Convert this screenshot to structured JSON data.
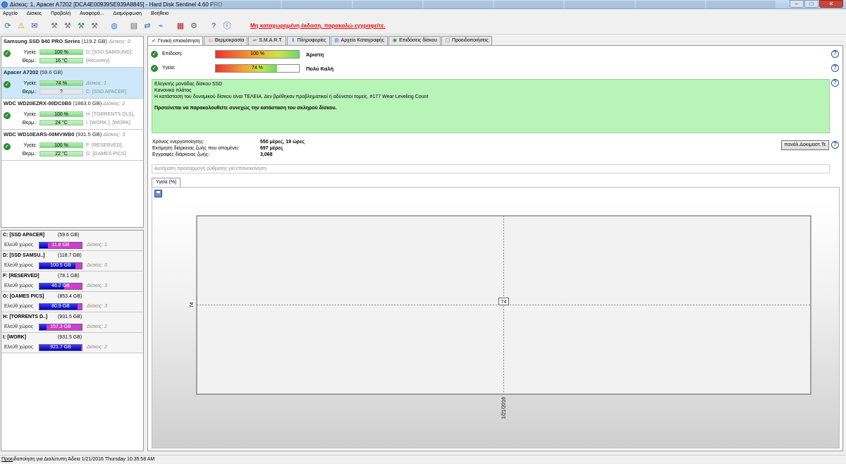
{
  "window": {
    "title": "Δίσκος: 1, Apacer A7202 [DCA4E00939SE939A8845]  -  Hard Disk Sentinel 4.60 PRO",
    "minimize": "–",
    "maximize": "□",
    "close": "✕"
  },
  "menu": [
    "Αρχείο",
    "Δίσκος",
    "Προβολή",
    "Αναφορά...",
    "Διαμόρφωση",
    "Βοήθεια"
  ],
  "toolbar": {
    "register_link": "Μη καταχωρημένη έκδοση, παρακαλώ εγγραφείτε."
  },
  "disks": [
    {
      "name": "Samsung SSD 840 PRO Series",
      "size": "(119.2 GB)",
      "disk_no": "Δίσκος: 0",
      "health_label": "Υγεία:",
      "health": "100 %",
      "health_vol": "D: [SSD SAMSUNG],",
      "temp_label": "Θερμ.:",
      "temp": "16 °C",
      "temp_vol": "[Recovery]"
    },
    {
      "name": "Apacer A7202",
      "size": "(59.6 GB)",
      "disk_no": "",
      "health_label": "Υγεία:",
      "health": "74 %",
      "health_vol": "Δίσκος: 1",
      "temp_label": "Θερμ.:",
      "temp": "?",
      "temp_vol": "C: [SSD APACER]"
    },
    {
      "name": "WDC WD20EZRX-00DC0B0",
      "size": "(1863.0 GB)",
      "disk_no": "Δίσκος: 2",
      "health_label": "Υγεία:",
      "health": "100 %",
      "health_vol": "H: [TORRENTS DLS],",
      "temp_label": "Θερμ.:",
      "temp": "24 °C",
      "temp_vol": "I: [WORK ],  [WORK]"
    },
    {
      "name": "WDC WD10EARS-00MVWB0",
      "size": "(931.5 GB)",
      "disk_no": "Δίσκος: 3",
      "health_label": "Υγεία:",
      "health": "100 %",
      "health_vol": "F: [RESERVED],",
      "temp_label": "Θερμ.:",
      "temp": "22 °C",
      "temp_vol": "G: [GAMES PICS]"
    }
  ],
  "volumes": [
    {
      "name": "C: [SSD APACER]",
      "size": "(59.6 GB)",
      "free_label": "Ελεύθ χώρος",
      "free": "11.8 GB",
      "free_fraction": 0.2,
      "disk": "Δίσκος: 1"
    },
    {
      "name": "D: [SSD SAMSU..]",
      "size": "(118.7 GB)",
      "free_label": "Ελεύθ χώρος",
      "free": "100.5 GB",
      "free_fraction": 0.85,
      "disk": "Δίσκος: 0"
    },
    {
      "name": "F: [RESERVED]",
      "size": "(78.1 GB)",
      "free_label": "Ελεύθ χώρος",
      "free": "46.2 GB",
      "free_fraction": 0.59,
      "disk": "Δίσκος: 3"
    },
    {
      "name": "G: [GAMES PICS]",
      "size": "(853.4 GB)",
      "free_label": "Ελεύθ χώρος",
      "free": "80.9 GB",
      "free_fraction": 0.9,
      "disk": "Δίσκος: 3"
    },
    {
      "name": "H: [TORRENTS D..]",
      "size": "(931.5 GB)",
      "free_label": "Ελεύθ χώρος",
      "free": "157.3 GB",
      "free_fraction": 0.17,
      "disk": "Δίσκος: 2"
    },
    {
      "name": "I: [WORK]",
      "size": "(931.5 GB)",
      "free_label": "Ελεύθ χώρος",
      "free": "921.7 GB",
      "free_fraction": 0.99,
      "disk": "Δίσκος: 2"
    }
  ],
  "tabs": [
    "Γενική επισκόπηση",
    "Θερμοκρασία",
    "S.M.A.R.T.",
    "Πληροφορίες",
    "Αρχείο Καταγραφής",
    "Επιδόσεις δίσκου",
    "Προειδοποιήσεις"
  ],
  "overview": {
    "performance_label": "Επίδοση:",
    "performance": "100 %",
    "performance_value": 100,
    "performance_rating": "Άριστη",
    "health_label": "Υγεία:",
    "health": "74 %",
    "health_value": 74,
    "health_rating": "Πολύ Καλή",
    "info": {
      "line1": "Ελεγκτής μονάδας δίσκου SSD",
      "line2": "Κανονικό πλάτος",
      "line3": "Η κατάσταση του δυναμικού δίσκου είναι ΤΕΛΕΙΑ. Δεν βρέθηκαν προβληματικοί ή αδύνατοι τομείς. #177 Wear Leveling Count",
      "recommendation": "Προτείνεται να παρακολουθείτε συνεχώς την κατάσταση του σκληρού δίσκου."
    },
    "stats": [
      {
        "label": "Χρόνος ενεργοποίησης:",
        "value": "550 μέρες, 19 ώρες"
      },
      {
        "label": "Εκτίμηση διάρκειας ζωής που απομένει:",
        "value": "697 μέρες"
      },
      {
        "label": "Εγγραφές διάρκειας ζωής:",
        "value": "3,068"
      }
    ],
    "test_button": "πανάλ.Δοκιμαστ.Τε",
    "auto_placeholder": "Αυτόματη προσαρμογή ρύθμισης για επανεκκίνηση",
    "chart_tab": "Υγεία (%)"
  },
  "chart_data": {
    "type": "scatter",
    "x": [
      "1/21/2016"
    ],
    "values": [
      74
    ],
    "data_labels": [
      "74"
    ],
    "ylabel": "74",
    "xlabel": "1/21/2016",
    "grid": true
  },
  "status": {
    "prefix": "Προε",
    "text": "ιδοποίηση για Διαλύτυπη  Άδεια 1/21/2016 Thursday 10:35:58 AM"
  }
}
